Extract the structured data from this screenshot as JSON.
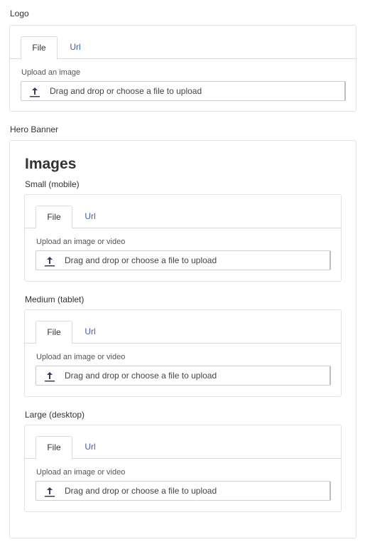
{
  "logo": {
    "label": "Logo",
    "tabs": [
      "File",
      "Url"
    ],
    "upload_label": "Upload an image",
    "dropzone_text": "Drag and drop or choose a file to upload"
  },
  "hero": {
    "label": "Hero Banner",
    "images_heading": "Images",
    "groups": [
      {
        "label": "Small (mobile)",
        "tabs": [
          "File",
          "Url"
        ],
        "upload_label": "Upload an image or video",
        "dropzone_text": "Drag and drop or choose a file to upload"
      },
      {
        "label": "Medium (tablet)",
        "tabs": [
          "File",
          "Url"
        ],
        "upload_label": "Upload an image or video",
        "dropzone_text": "Drag and drop or choose a file to upload"
      },
      {
        "label": "Large (desktop)",
        "tabs": [
          "File",
          "Url"
        ],
        "upload_label": "Upload an image or video",
        "dropzone_text": "Drag and drop or choose a file to upload"
      }
    ]
  },
  "colors": {
    "link": "#3b5bab",
    "border": "#e3e3e3",
    "text": "#333333"
  },
  "icons": {
    "upload": "upload-icon"
  }
}
